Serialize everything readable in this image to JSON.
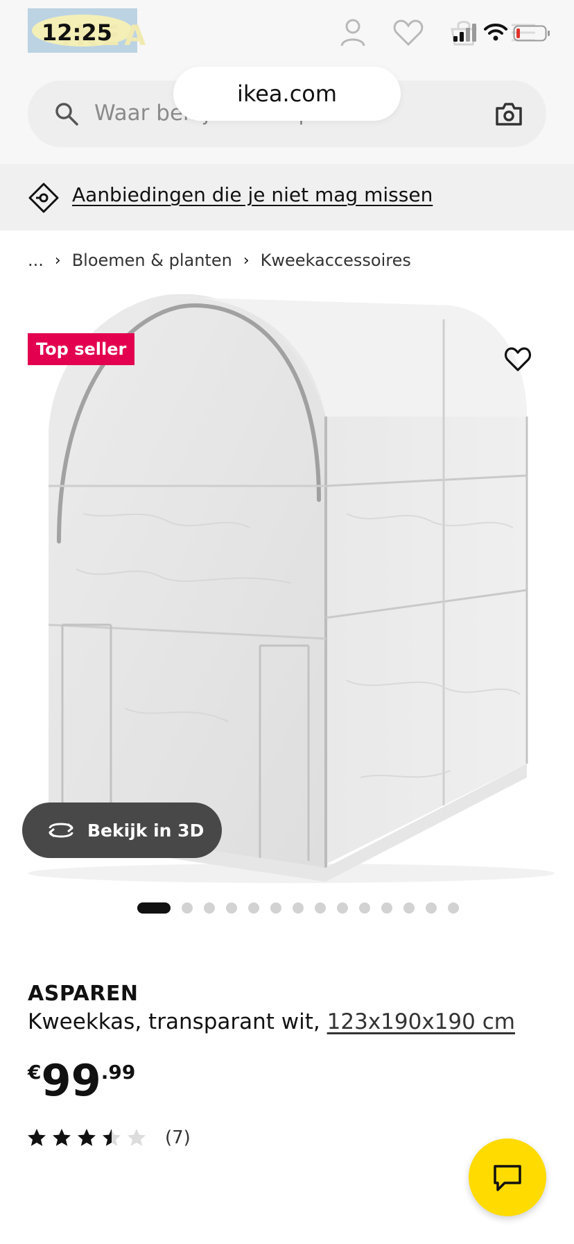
{
  "status_bar": {
    "time": "12:25",
    "logo_text": "IKEA",
    "signal_icon": "signal-bars-icon",
    "wifi_icon": "wifi-icon",
    "battery_icon": "battery-low-icon",
    "battery_color": "#e0332a"
  },
  "header": {
    "url": "ikea.com",
    "search_placeholder": "Waar ben je naar op zoek?",
    "icons": [
      "profile-icon",
      "heart-icon",
      "shopping-bag-icon",
      "menu-icon",
      "search-icon",
      "camera-icon"
    ]
  },
  "promo": {
    "label": "Aanbiedingen die je niet mag missen",
    "icon": "tag-offer-icon"
  },
  "breadcrumb": {
    "items": [
      "...",
      "Bloemen & planten",
      "Kweekaccessoires"
    ]
  },
  "product": {
    "badge": "Top seller",
    "badge_color": "#e3004f",
    "view_3d_label": "Bekijk in 3D",
    "image_count": 14,
    "active_image": 1,
    "name": "ASPAREN",
    "description": "Kweekkas, transparant wit,",
    "dimensions": "123x190x190 cm",
    "price": {
      "currency": "€",
      "integer": "99",
      "decimal": ".99"
    },
    "rating_value": 3.5,
    "rating_max": 5,
    "review_count": "(7)"
  },
  "chat": {
    "icon": "chat-bubble-icon",
    "color": "#ffdb00"
  }
}
